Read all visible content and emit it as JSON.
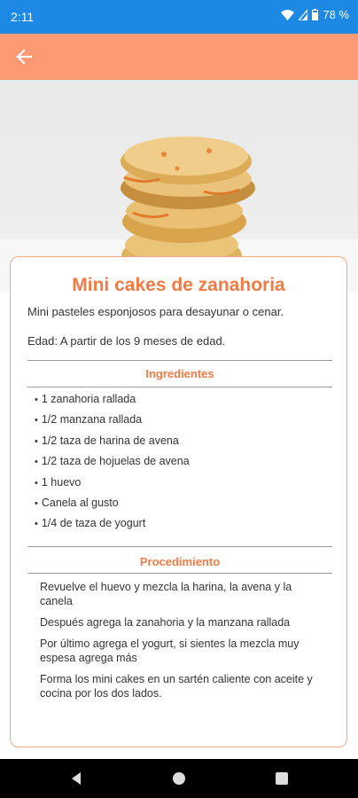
{
  "status_bar": {
    "time": "2:11",
    "battery": "78 %",
    "icons": [
      "wifi-icon",
      "signal-icon",
      "battery-icon"
    ]
  },
  "app_bar": {
    "color": "#fb9a73",
    "back_icon": "arrow-left-icon"
  },
  "recipe": {
    "title": "Mini cakes de zanahoria",
    "description": "Mini pasteles esponjosos para desayunar o cenar.",
    "age": "Edad: A partir de los 9 meses de edad.",
    "ingredients_heading": "Ingredientes",
    "ingredients": [
      "1 zanahoria rallada",
      "1/2 manzana rallada",
      "1/2 taza de harina de avena",
      "1/2 taza de hojuelas de avena",
      "1 huevo",
      "Canela al gusto",
      "1/4 de taza de yogurt"
    ],
    "procedure_heading": "Procedimiento",
    "steps": [
      "Revuelve el huevo y mezcla la harina, la avena y la canela",
      "Después agrega la zanahoria y la manzana rallada",
      "Por último agrega el yogurt, si sientes la mezcla muy espesa agrega más",
      "Forma los mini cakes en un sartén caliente con aceite y cocina por los dos lados."
    ],
    "accent_color": "#f27a45"
  },
  "nav_bar": {
    "icons": [
      "back-triangle-icon",
      "home-circle-icon",
      "recents-square-icon"
    ]
  }
}
